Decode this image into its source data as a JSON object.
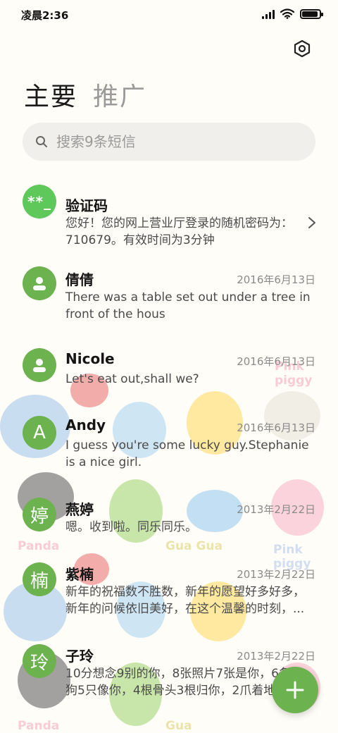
{
  "status_bar": {
    "time": "凌晨2:36",
    "battery_level": 0.9
  },
  "tabs": [
    {
      "label": "主要",
      "active": true
    },
    {
      "label": "推广",
      "active": false
    }
  ],
  "search": {
    "placeholder": "搜索9条短信"
  },
  "messages": [
    {
      "avatar_text": "**_",
      "avatar_type": "code",
      "name": "验证码",
      "date": "",
      "preview": "您好！您的网上营业厅登录的随机密码为：710679。有效时间为3分钟",
      "has_chevron": true
    },
    {
      "avatar_icon": "person-icon",
      "name": "倩倩",
      "date": "2016年6月13日",
      "preview": "There was a table set out under a tree in front of the hous"
    },
    {
      "avatar_icon": "person-icon",
      "name": "Nicole",
      "date": "2016年6月13日",
      "preview": "Let's eat out,shall we?"
    },
    {
      "avatar_text": "A",
      "name": "Andy",
      "date": "2016年6月13日",
      "preview": "I guess you're some lucky guy.Stephanie is a nice girl."
    },
    {
      "avatar_text": "婷",
      "name": "燕婷",
      "date": "2013年2月22日",
      "preview": "嗯。收到啦。同乐同乐。"
    },
    {
      "avatar_text": "楠",
      "name": "紫楠",
      "date": "2013年2月22日",
      "preview": "新年的祝福数不胜数，新年的愿望好多好多，新年的问候依旧美好，在这个温馨的时刻，..."
    },
    {
      "avatar_text": "玲",
      "name": "子玲",
      "date": "2013年2月22日",
      "preview": "10分想念9别的你，8张照片7张是你，6条小狗5只像你，4根骨头3根归你，2爪着地"
    }
  ],
  "background_words": [
    "Pink piggy",
    "Panda",
    "Gua Gua",
    "Pink piggy",
    "Panda",
    "Gua"
  ],
  "colors": {
    "accent": "#6cb24f",
    "code_avatar": "#5ec95a",
    "background": "#fffdf8"
  }
}
